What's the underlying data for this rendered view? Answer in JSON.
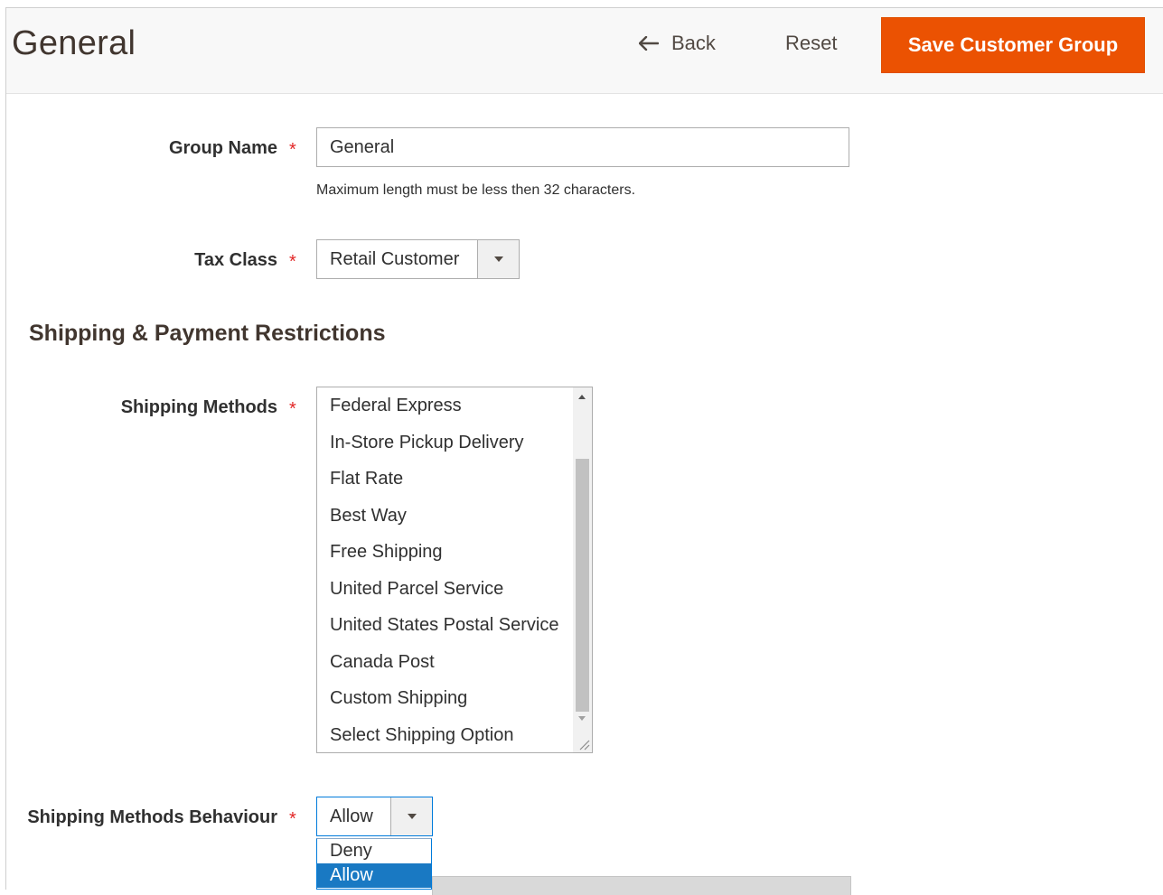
{
  "header": {
    "title": "General",
    "back_label": "Back",
    "reset_label": "Reset",
    "save_label": "Save Customer Group",
    "save_color": "#eb5202"
  },
  "form": {
    "group_name": {
      "label": "Group Name",
      "required_mark": "*",
      "value": "General",
      "note": "Maximum length must be less then 32 characters."
    },
    "tax_class": {
      "label": "Tax Class",
      "required_mark": "*",
      "selected": "Retail Customer"
    },
    "section_title": "Shipping & Payment Restrictions",
    "shipping_methods": {
      "label": "Shipping Methods",
      "required_mark": "*",
      "options": [
        "Federal Express",
        "In-Store Pickup Delivery",
        "Flat Rate",
        "Best Way",
        "Free Shipping",
        "United Parcel Service",
        "United States Postal Service",
        "Canada Post",
        "Custom Shipping",
        "Select Shipping Option"
      ]
    },
    "shipping_behaviour": {
      "label": "Shipping Methods Behaviour",
      "required_mark": "*",
      "selected": "Allow",
      "options": [
        "Deny",
        "Allow"
      ],
      "highlight_color": "#1979c3"
    }
  }
}
